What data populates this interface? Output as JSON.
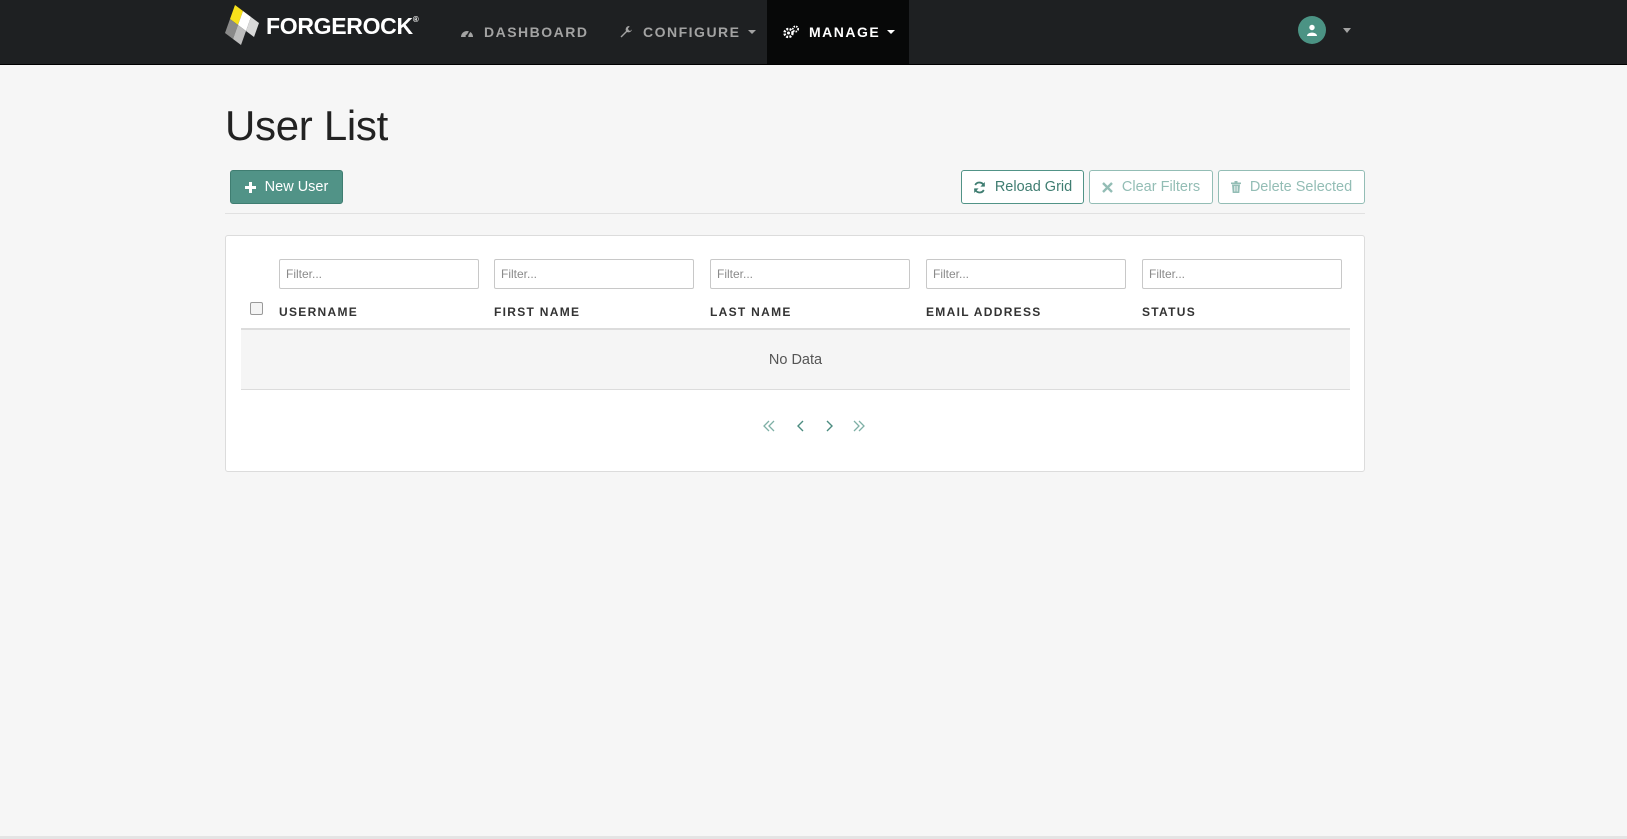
{
  "brand": {
    "name": "FORGEROCK",
    "mark": "®"
  },
  "nav": {
    "dashboard": "DASHBOARD",
    "configure": "CONFIGURE",
    "manage": "MANAGE"
  },
  "page": {
    "title": "User List"
  },
  "toolbar": {
    "new_user": "New User",
    "reload_grid": "Reload Grid",
    "clear_filters": "Clear Filters",
    "delete_selected": "Delete Selected"
  },
  "grid": {
    "filter_placeholder": "Filter...",
    "columns": [
      "USERNAME",
      "FIRST NAME",
      "LAST NAME",
      "EMAIL ADDRESS",
      "STATUS"
    ],
    "empty_text": "No Data"
  },
  "colors": {
    "navbar": "#1e2022",
    "active_nav": "#070808",
    "accent": "#519387",
    "background": "#f6f6f6"
  },
  "icons": {
    "dashboard": "dashboard-gauge-icon",
    "configure": "wrench-icon",
    "manage": "gears-icon",
    "user": "user-avatar-icon",
    "new_user": "plus-icon",
    "reload": "refresh-icon",
    "clear": "x-icon",
    "delete": "trash-icon"
  }
}
